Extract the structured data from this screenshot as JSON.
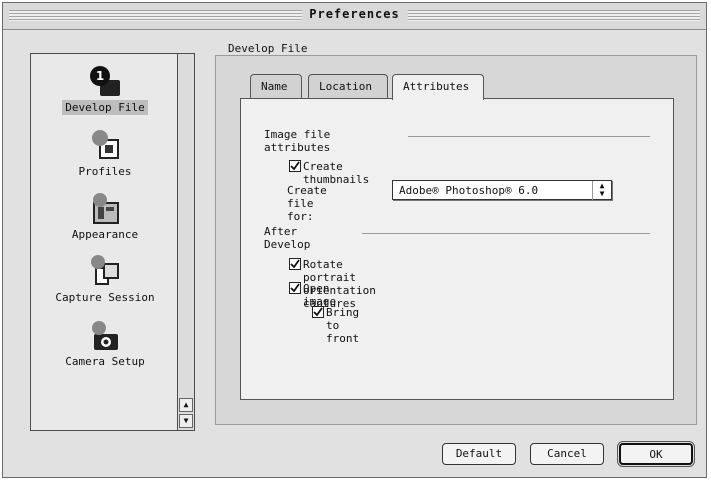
{
  "window": {
    "title": "Preferences"
  },
  "sidebar": {
    "items": [
      {
        "label": "Develop File",
        "icon": "develop-file-icon",
        "selected": true
      },
      {
        "label": "Profiles",
        "icon": "profiles-icon",
        "selected": false
      },
      {
        "label": "Appearance",
        "icon": "appearance-icon",
        "selected": false
      },
      {
        "label": "Capture Session",
        "icon": "capture-session-icon",
        "selected": false
      },
      {
        "label": "Camera Setup",
        "icon": "camera-setup-icon",
        "selected": false
      }
    ]
  },
  "group": {
    "label": "Develop File"
  },
  "tabs": [
    {
      "label": "Name",
      "active": false
    },
    {
      "label": "Location",
      "active": false
    },
    {
      "label": "Attributes",
      "active": true
    }
  ],
  "attributes": {
    "image_section_label": "Image file attributes",
    "create_thumbnails": {
      "label": "Create thumbnails",
      "checked": true
    },
    "create_file_for": {
      "label": "Create file for:",
      "value": "Adobe® Photoshop® 6.0"
    },
    "after_section_label": "After Develop",
    "rotate_portrait": {
      "label": "Rotate portrait orientation captures",
      "checked": true
    },
    "open_image": {
      "label": "Open image",
      "checked": true
    },
    "bring_to_front": {
      "label": "Bring to front",
      "checked": true
    }
  },
  "buttons": {
    "default": "Default",
    "cancel": "Cancel",
    "ok": "OK"
  }
}
